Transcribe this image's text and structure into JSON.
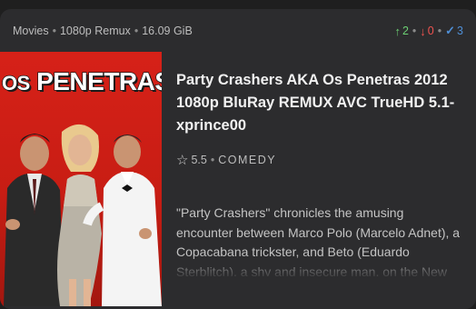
{
  "card": {
    "meta": {
      "category": "Movies",
      "quality": "1080p Remux",
      "size": "16.09 GiB"
    },
    "stats": {
      "seeders": "2",
      "leechers": "0",
      "completed": "3"
    },
    "poster": {
      "title_small": "OS",
      "title_large": "PENETRAS",
      "background_color": "#d62118"
    },
    "title": "Party Crashers AKA Os Penetras 2012 1080p BluRay REMUX AVC TrueHD 5.1-xprince00",
    "rating": "5.5",
    "genre": "COMEDY",
    "description": "\"Party Crashers\" chronicles the amusing encounter between Marco Polo (Marcelo Adnet), a Copacabana trickster, and Beto (Eduardo Sterblitch), a shy and insecure man, on the New"
  },
  "icons": {
    "seeders": "arrow-up-icon",
    "leechers": "arrow-down-icon",
    "completed": "check-icon",
    "rating": "star-outline-icon"
  },
  "colors": {
    "seeders": "#6ccf73",
    "leechers": "#ef5350",
    "completed": "#4f8fd6",
    "card_bg": "#2c2c2e"
  }
}
